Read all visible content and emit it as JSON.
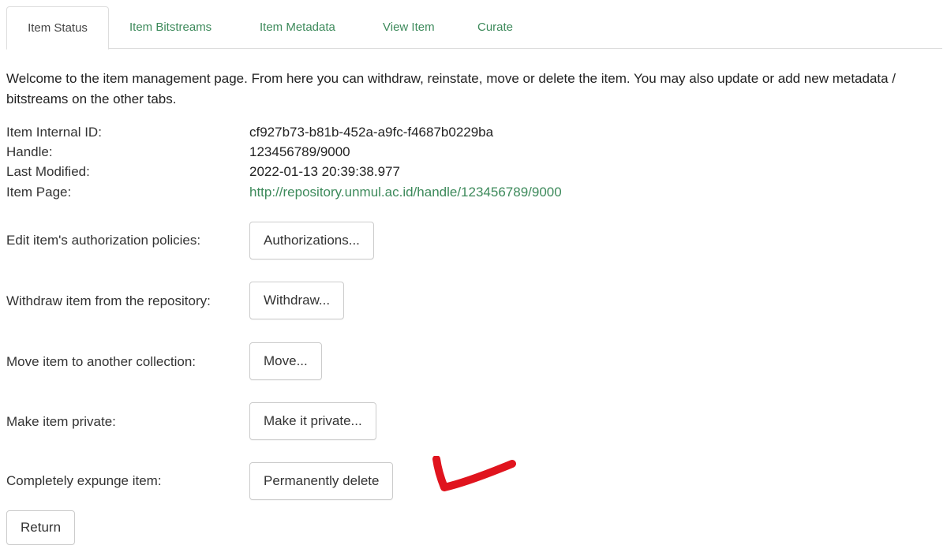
{
  "tabs": [
    {
      "label": "Item Status",
      "active": true
    },
    {
      "label": "Item Bitstreams",
      "active": false
    },
    {
      "label": "Item Metadata",
      "active": false
    },
    {
      "label": "View Item",
      "active": false
    },
    {
      "label": "Curate",
      "active": false
    }
  ],
  "intro": "Welcome to the item management page. From here you can withdraw, reinstate, move or delete the item. You may also update or add new metadata / bitstreams on the other tabs.",
  "info": {
    "internal_id_label": "Item Internal ID:",
    "internal_id_value": "cf927b73-b81b-452a-a9fc-f4687b0229ba",
    "handle_label": "Handle:",
    "handle_value": "123456789/9000",
    "modified_label": "Last Modified:",
    "modified_value": "2022-01-13 20:39:38.977",
    "page_label": "Item Page:",
    "page_value": "http://repository.unmul.ac.id/handle/123456789/9000"
  },
  "actions": {
    "authorizations_label": "Edit item's authorization policies:",
    "authorizations_button": "Authorizations...",
    "withdraw_label": "Withdraw item from the repository:",
    "withdraw_button": "Withdraw...",
    "move_label": "Move item to another collection:",
    "move_button": "Move...",
    "private_label": "Make item private:",
    "private_button": "Make it private...",
    "delete_label": "Completely expunge item:",
    "delete_button": "Permanently delete"
  },
  "return_button": "Return",
  "colors": {
    "link": "#3d8a5b",
    "annotation": "#e0141e"
  }
}
